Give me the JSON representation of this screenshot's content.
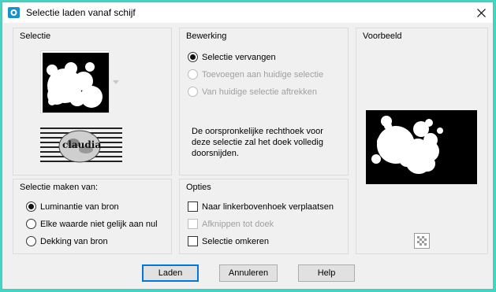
{
  "window": {
    "title": "Selectie laden vanaf schijf",
    "frame_color": "#3fd6c4"
  },
  "selectie": {
    "title": "Selectie",
    "thumbnail_caption": "claudia"
  },
  "bewerking": {
    "title": "Bewerking",
    "options": [
      {
        "label": "Selectie vervangen",
        "checked": true,
        "enabled": true
      },
      {
        "label": "Toevoegen aan huidige selectie",
        "checked": false,
        "enabled": false
      },
      {
        "label": "Van huidige selectie aftrekken",
        "checked": false,
        "enabled": false
      }
    ],
    "note_lines": [
      "De oorspronkelijke rechthoek voor",
      "deze selectie zal het doek volledig",
      "doorsnijden."
    ]
  },
  "voorbeeld": {
    "title": "Voorbeeld",
    "icon": "checkerboard-icon"
  },
  "maken_van": {
    "title": "Selectie maken van:",
    "options": [
      {
        "label": "Luminantie van bron",
        "checked": true
      },
      {
        "label": "Elke waarde niet gelijk aan nul",
        "checked": false
      },
      {
        "label": "Dekking van bron",
        "checked": false
      }
    ]
  },
  "opties": {
    "title": "Opties",
    "items": [
      {
        "label": "Naar linkerbovenhoek verplaatsen",
        "checked": false,
        "enabled": true
      },
      {
        "label": "Afknippen tot doek",
        "checked": false,
        "enabled": false
      },
      {
        "label": "Selectie omkeren",
        "checked": false,
        "enabled": true
      }
    ]
  },
  "buttons": {
    "load": "Laden",
    "cancel": "Annuleren",
    "help": "Help"
  }
}
